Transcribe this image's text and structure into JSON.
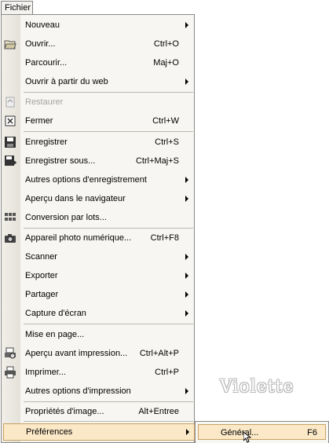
{
  "menubar": {
    "file_label": "Fichier"
  },
  "menu": {
    "items": [
      {
        "label": "Nouveau",
        "shortcut": "",
        "submenu": true
      },
      {
        "label": "Ouvrir...",
        "shortcut": "Ctrl+O",
        "icon": "open-folder-icon"
      },
      {
        "label": "Parcourir...",
        "shortcut": "Maj+O"
      },
      {
        "label": "Ouvrir à partir du web",
        "shortcut": "",
        "submenu": true
      },
      {
        "label": "Restaurer",
        "shortcut": "",
        "disabled": true,
        "icon": "restore-icon"
      },
      {
        "label": "Fermer",
        "shortcut": "Ctrl+W",
        "icon": "close-file-icon"
      },
      {
        "label": "Enregistrer",
        "shortcut": "Ctrl+S",
        "icon": "save-icon"
      },
      {
        "label": "Enregistrer sous...",
        "shortcut": "Ctrl+Maj+S",
        "icon": "save-as-icon"
      },
      {
        "label": "Autres options d'enregistrement",
        "shortcut": "",
        "submenu": true
      },
      {
        "label": "Aperçu dans le navigateur",
        "shortcut": "",
        "submenu": true
      },
      {
        "label": "Conversion par lots...",
        "shortcut": "",
        "icon": "batch-convert-icon"
      },
      {
        "label": "Appareil photo numérique...",
        "shortcut": "Ctrl+F8",
        "icon": "camera-icon"
      },
      {
        "label": "Scanner",
        "shortcut": "",
        "submenu": true
      },
      {
        "label": "Exporter",
        "shortcut": "",
        "submenu": true
      },
      {
        "label": "Partager",
        "shortcut": "",
        "submenu": true
      },
      {
        "label": "Capture d'écran",
        "shortcut": "",
        "submenu": true
      },
      {
        "label": "Mise en page...",
        "shortcut": ""
      },
      {
        "label": "Aperçu avant impression...",
        "shortcut": "Ctrl+Alt+P",
        "icon": "print-preview-icon"
      },
      {
        "label": "Imprimer...",
        "shortcut": "Ctrl+P",
        "icon": "printer-icon"
      },
      {
        "label": "Autres options d'impression",
        "shortcut": "",
        "submenu": true
      },
      {
        "label": "Propriétés d'image...",
        "shortcut": "Alt+Entree"
      },
      {
        "label": "Préférences",
        "shortcut": "",
        "submenu": true,
        "highlighted": true
      }
    ]
  },
  "submenu": {
    "item_label": "Général...",
    "item_shortcut": "F6"
  },
  "watermark": "Violette",
  "colors": {
    "highlight": "#fbe8c6",
    "highlight_border": "#c8a263",
    "menu_bg": "#f7f6f3"
  }
}
